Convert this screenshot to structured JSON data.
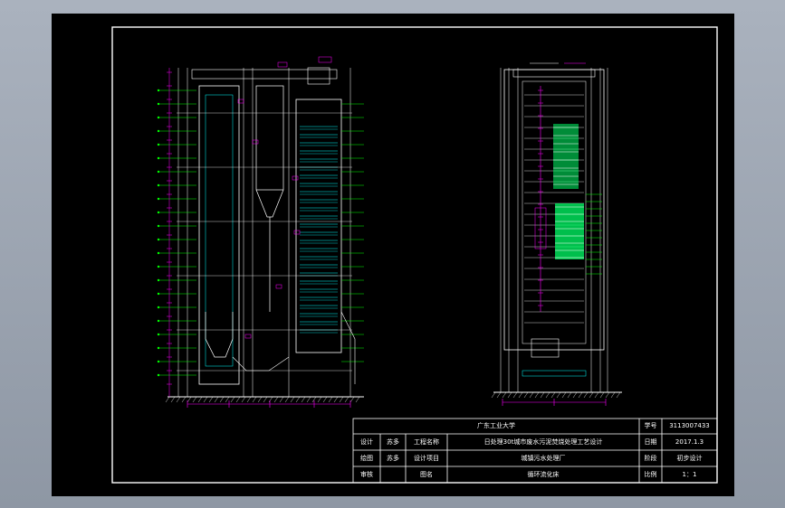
{
  "drawing": {
    "colors": {
      "background": "#000000",
      "frame": "#ffffff",
      "structure": "#ffffff",
      "dimension": "#00ff00",
      "annotation": "#ff00ff",
      "accent": "#00ffff",
      "filter": "#00ff66"
    },
    "title_block": {
      "school": "广东工业大学",
      "student_no_label": "学号",
      "student_no": "3113007433",
      "designer_label": "设计",
      "designer": "苏多",
      "project_name_label": "工程名称",
      "project_name": "日处理30t城市废水污泥焚烧处理工艺设计",
      "date_label": "日期",
      "date": "2017.1.3",
      "drafter_label": "绘图",
      "drafter": "苏多",
      "design_item_label": "设计项目",
      "design_item": "城镇污水处理厂",
      "stage_label": "阶段",
      "stage": "初步设计",
      "reviewer_label": "审核",
      "reviewer": "",
      "drawing_name_label": "图名",
      "drawing_name": "循环流化床",
      "scale_label": "比例",
      "scale": "1：1"
    }
  }
}
